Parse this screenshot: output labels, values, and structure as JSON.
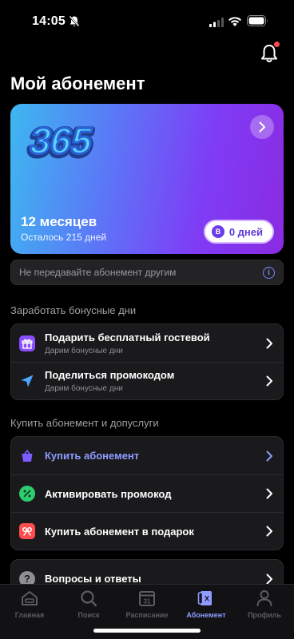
{
  "status": {
    "time": "14:05"
  },
  "page": {
    "title": "Мой абонемент"
  },
  "card": {
    "logo_text": "365",
    "period": "12 месяцев",
    "remaining": "Осталось 215 дней",
    "bonus_badge": "В",
    "bonus_days": "0 дней"
  },
  "notice": {
    "text": "Не передавайте абонемент другим"
  },
  "sections": {
    "bonus_header": "Заработать бонусные дни",
    "buy_header": "Купить абонемент и допуслуги"
  },
  "bonus_items": [
    {
      "label": "Подарить бесплатный гостевой",
      "sub": "Дарим бонусные дни"
    },
    {
      "label": "Поделиться промокодом",
      "sub": "Дарим бонусные дни"
    }
  ],
  "buy_items": [
    {
      "label": "Купить абонемент"
    },
    {
      "label": "Активировать промокод"
    },
    {
      "label": "Купить абонемент в подарок"
    }
  ],
  "faq": {
    "label": "Вопросы и ответы"
  },
  "tabs": [
    {
      "label": "Главная"
    },
    {
      "label": "Поиск"
    },
    {
      "label": "Расписание",
      "icon_text": "31"
    },
    {
      "label": "Абонемент"
    },
    {
      "label": "Профиль"
    }
  ],
  "colors": {
    "accent": "#8f9bff",
    "badge": "#ff4d4d",
    "gift_icon": "#8a4dff",
    "promo_icon": "#2ecc71",
    "present_icon": "#ff4d4d"
  }
}
